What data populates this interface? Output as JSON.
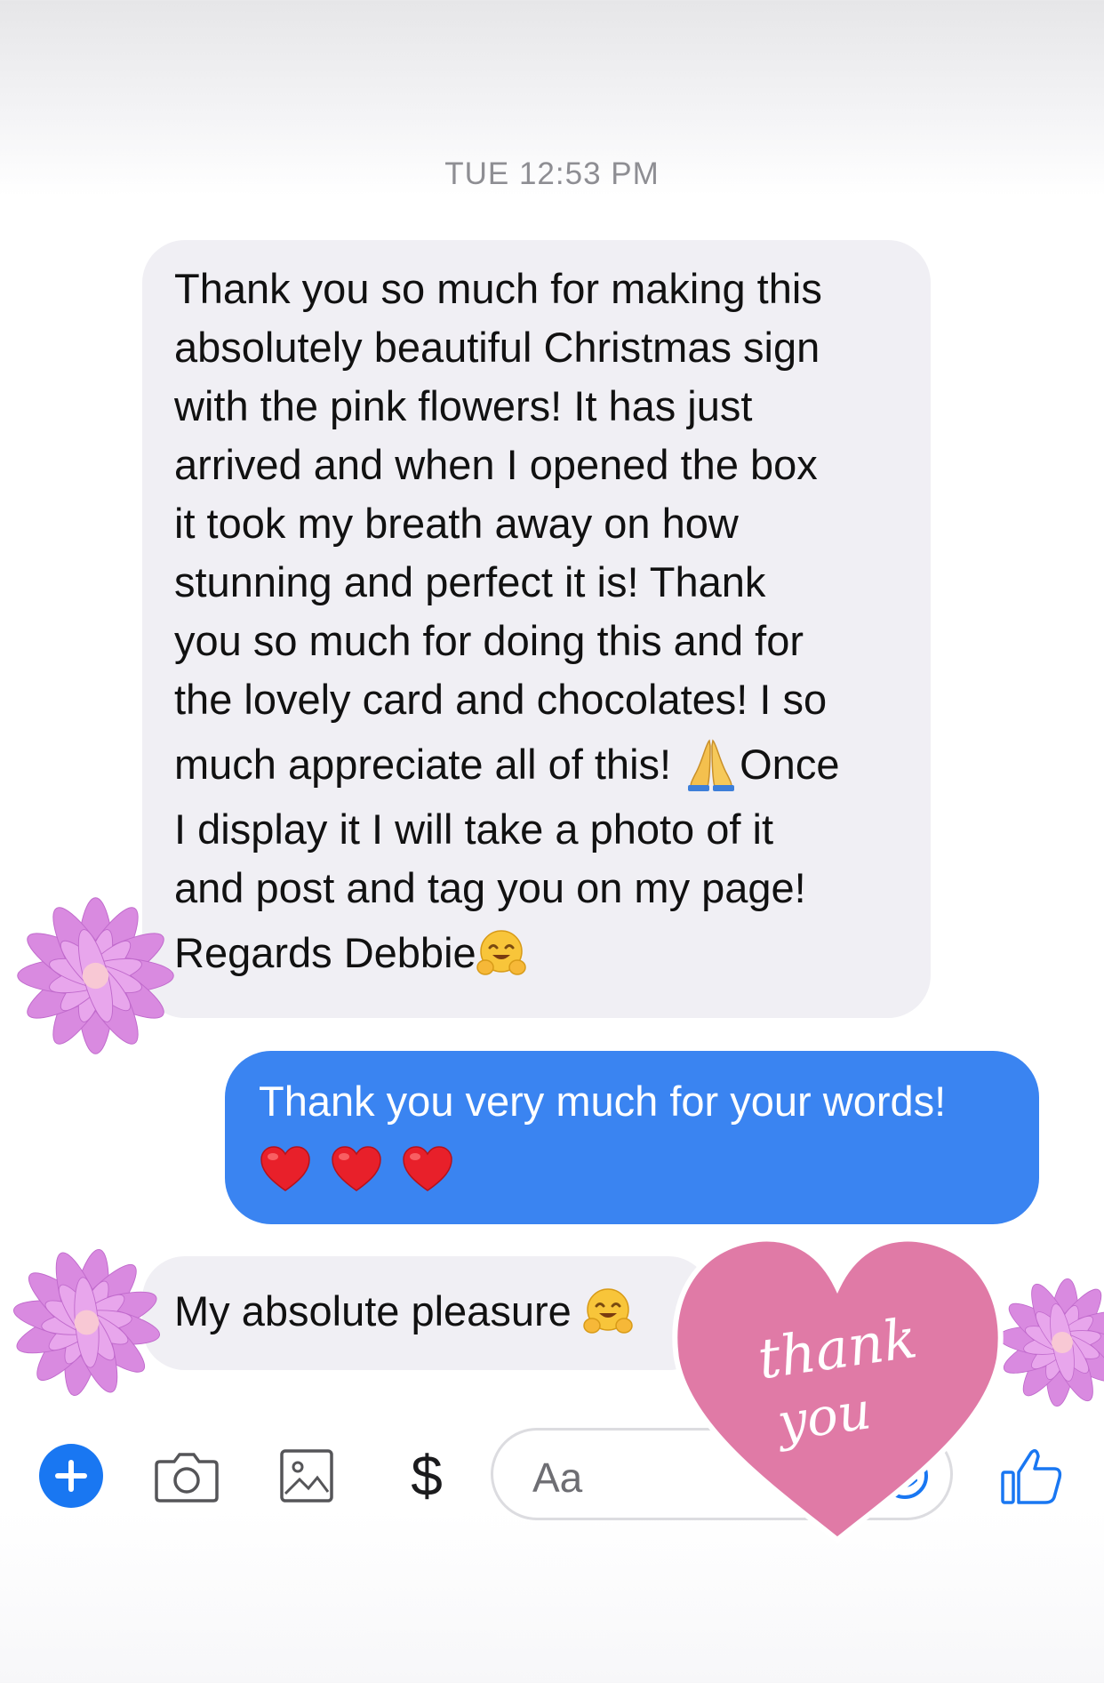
{
  "thread": {
    "timestamp": "TUE 12:53 PM"
  },
  "messages": [
    {
      "sender": "incoming",
      "lines": [
        "Thank you so much for making this",
        "absolutely beautiful Christmas sign",
        "with the pink flowers! It has just",
        "arrived and when I opened the box",
        "it took my breath away on how",
        "stunning and perfect it is! Thank",
        "you so much for doing this and for",
        "the lovely card and chocolates! I so",
        "much appreciate all of this! ",
        "Once",
        "I display it I will take a photo of it",
        "and post and tag you on my page!",
        "Regards Debbie"
      ],
      "emojis": [
        "folded-hands",
        "hugging-face"
      ]
    },
    {
      "sender": "outgoing",
      "text": "Thank you very much for your words!",
      "emojis": [
        "red-heart",
        "red-heart",
        "red-heart"
      ]
    },
    {
      "sender": "incoming",
      "text": "My absolute pleasure ",
      "emojis": [
        "hugging-face"
      ]
    }
  ],
  "composer": {
    "plus_icon": "plus-icon",
    "camera_icon": "camera-icon",
    "image_icon": "image-icon",
    "payment_label": "$",
    "input_placeholder": "Aa",
    "emoji_icon": "smiley-icon",
    "like_icon": "thumbs-up-icon"
  },
  "stickers": {
    "heart_text_1": "thank",
    "heart_text_2": "you",
    "flower_count": 3
  },
  "colors": {
    "incoming_bubble": "#f0eff4",
    "outgoing_bubble": "#3a84f1",
    "accent": "#1977f2",
    "heart_sticker": "#e07aa6",
    "flower_petals": "#d98ae0"
  }
}
